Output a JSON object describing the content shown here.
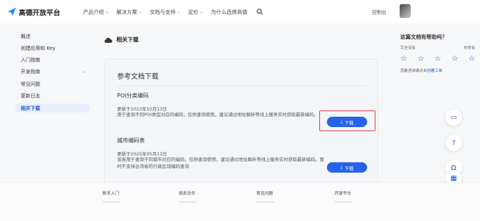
{
  "brand": {
    "name": "高德开放平台",
    "accent": "#1a56db"
  },
  "nav": {
    "items": [
      {
        "label": "产品介绍",
        "chevron": true
      },
      {
        "label": "解决方案",
        "chevron": true
      },
      {
        "label": "文档与支持",
        "chevron": true
      },
      {
        "label": "定价",
        "chevron": true
      },
      {
        "label": "为什么选择高德",
        "chevron": false
      }
    ],
    "console": "控制台"
  },
  "sidebar": {
    "items": [
      {
        "label": "概述"
      },
      {
        "label": "创建应用和 Key"
      },
      {
        "label": "入门指南"
      },
      {
        "label": "开发指南",
        "chevron": true
      },
      {
        "label": "常见问题"
      },
      {
        "label": "更新日志"
      },
      {
        "label": "相关下载",
        "active": true
      }
    ]
  },
  "main": {
    "section_title": "相关下载",
    "card_title": "参考文档下载",
    "docs": [
      {
        "name": "POI分类编码",
        "date": "更新于2023年10月13日",
        "desc": "用于查询不同POI类型对应的编码。仅供查询使用，建议通过地址解析等线上服务实时获取最新编码。",
        "button": "下载"
      },
      {
        "name": "城市编码表",
        "date": "更新于2025年05月13日",
        "desc": "该表用于查询不同城市对应的编码。仅供查询使用，建议通过地址解析等线上服务实时获取最新编码。暂时不支持台湾省的行政区域编码查询",
        "button": "下载"
      }
    ]
  },
  "feedback": {
    "title": "这篇文档有帮助吗？",
    "low": "完全没有",
    "high": "非常有",
    "stars": [
      "☆",
      "☆",
      "☆",
      "☆",
      "☆"
    ],
    "note_prefix": "您能咨询请点击",
    "note_link": "创建工单"
  },
  "floating": [
    {
      "icon": "monitor-icon",
      "glyph": "▭"
    },
    {
      "icon": "help-icon",
      "glyph": "?"
    },
    {
      "icon": "headset-icon",
      "glyph": "Ω"
    },
    {
      "icon": "apps-icon",
      "glyph": "▦"
    }
  ],
  "footer": {
    "columns": [
      "新手入门",
      "商务合作",
      "常见问题",
      "开放平台"
    ]
  }
}
